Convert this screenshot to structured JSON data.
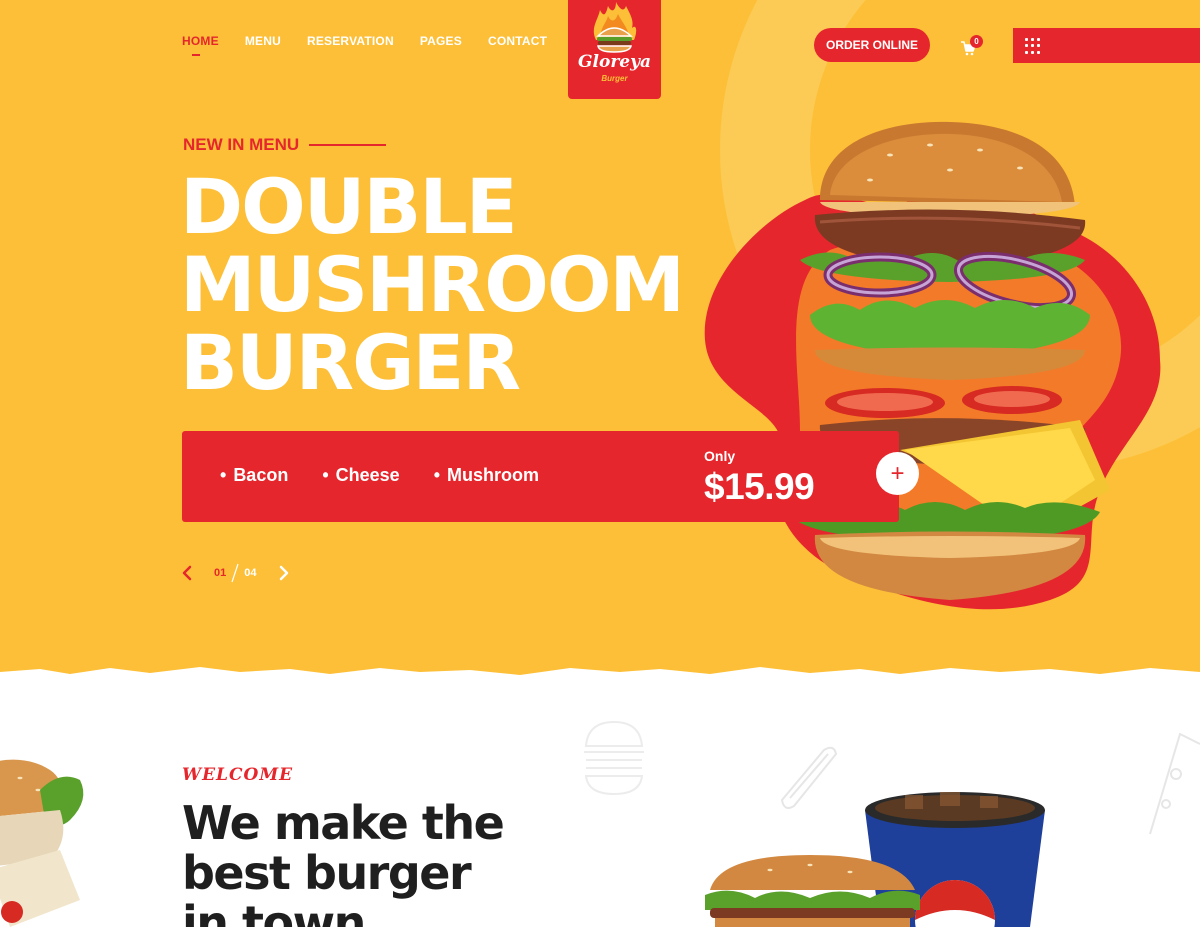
{
  "nav": {
    "items": [
      {
        "label": "HOME",
        "active": true
      },
      {
        "label": "MENU"
      },
      {
        "label": "RESERVATION"
      },
      {
        "label": "PAGES"
      },
      {
        "label": "CONTACT"
      }
    ]
  },
  "logo": {
    "name": "Gloreya",
    "sub": "Burger"
  },
  "header": {
    "order_label": "ORDER ONLINE",
    "cart_count": "0"
  },
  "hero": {
    "eyebrow": "NEW IN MENU",
    "title_lines": [
      "DOUBLE",
      "MUSHROOM",
      "BURGER"
    ],
    "ingredients": [
      "Bacon",
      "Cheese",
      "Mushroom"
    ],
    "price_prefix": "Only",
    "price": "$15.99",
    "pager": {
      "current": "01",
      "total": "04"
    }
  },
  "welcome": {
    "eyebrow": "WELCOME",
    "title_lines": [
      "We make the",
      "best burger",
      "in town"
    ]
  },
  "colors": {
    "primary": "#e5272d",
    "hero_bg": "#fdbf37",
    "text_dark": "#1f1f1f"
  },
  "icons": [
    "flame-icon",
    "burger-icon",
    "cart-icon",
    "menu-grid-icon",
    "plus-icon",
    "chevron-left-icon",
    "chevron-right-icon",
    "hotdog-doodle-icon",
    "pizza-doodle-icon"
  ]
}
